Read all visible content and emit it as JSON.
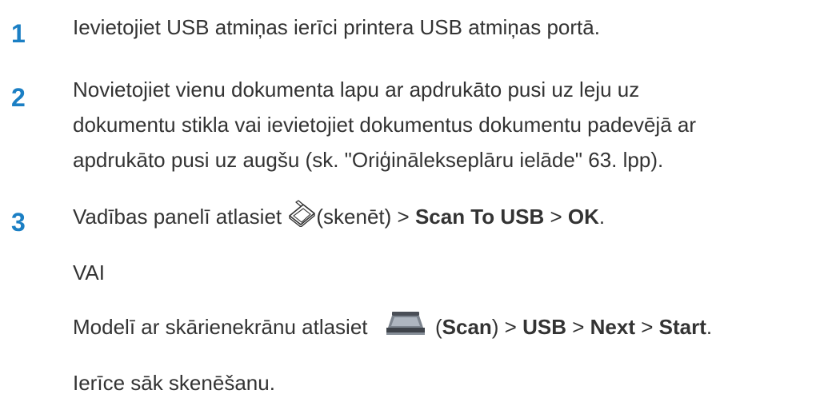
{
  "steps": [
    {
      "number": "1",
      "text": "Ievietojiet USB atmiņas ierīci printera USB atmiņas portā."
    },
    {
      "number": "2",
      "lines": [
        "Novietojiet vienu dokumenta lapu ar apdrukāto pusi uz leju uz",
        "dokumentu stikla vai ievietojiet dokumentus dokumentu padevējā ar",
        "apdrukāto pusi uz augšu (sk. \"Oriģinālekseplāru ielāde\" 63. lpp)."
      ]
    },
    {
      "number": "3",
      "line1": {
        "prefix": "Vadības panelī atlasiet ",
        "icon": "scanner-flatbed-icon",
        "icon_label": "(skenēt) > ",
        "scan_to_usb": "Scan To USB",
        "sep": " > ",
        "ok": "OK",
        "end": "."
      },
      "or": "VAI",
      "line2": {
        "prefix": "Modelī ar skārienekrānu atlasiet ",
        "icon": "scan-button-icon",
        "open": " (",
        "scan": "Scan",
        "close": ") > ",
        "usb": "USB",
        "sep1": " > ",
        "next": "Next",
        "sep2": " > ",
        "start": "Start",
        "end": "."
      },
      "result": "Ierīce sāk skenēšanu."
    }
  ],
  "colors": {
    "step_number": "#1b7fc4",
    "text": "#333333"
  }
}
